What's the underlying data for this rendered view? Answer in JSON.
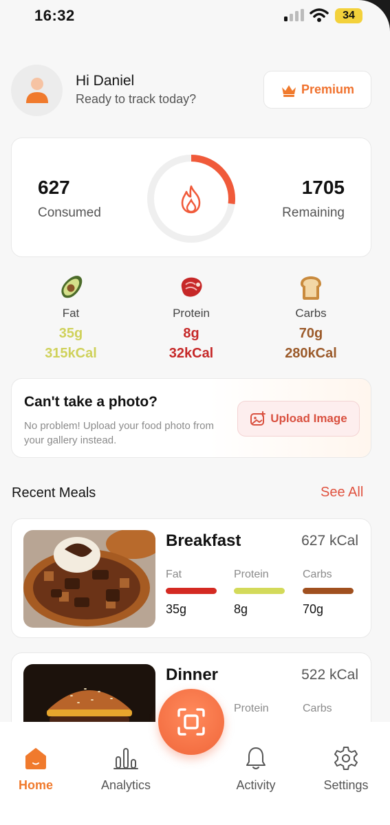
{
  "status_bar": {
    "time": "16:32",
    "battery": "34"
  },
  "header": {
    "greeting": "Hi Daniel",
    "subtitle": "Ready to track today?",
    "premium_label": "Premium"
  },
  "calories": {
    "consumed_value": "627",
    "consumed_label": "Consumed",
    "remaining_value": "1705",
    "remaining_label": "Remaining",
    "ring_progress": 0.27,
    "ring_color": "#f05a3a"
  },
  "macros": [
    {
      "name": "Fat",
      "grams": "35g",
      "kcal": "315kCal",
      "color": "#cfd15a",
      "icon": "avocado-icon"
    },
    {
      "name": "Protein",
      "grams": "8g",
      "kcal": "32kCal",
      "color": "#c62828",
      "icon": "steak-icon"
    },
    {
      "name": "Carbs",
      "grams": "70g",
      "kcal": "280kCal",
      "color": "#9b5a2a",
      "icon": "bread-icon"
    }
  ],
  "photo_card": {
    "title": "Can't take a photo?",
    "description": "No problem! Upload your food photo from your gallery instead.",
    "button_label": "Upload Image"
  },
  "recent_meals": {
    "title": "Recent Meals",
    "see_all": "See All",
    "items": [
      {
        "name": "Breakfast",
        "kcal": "627 kCal",
        "macros": [
          {
            "label": "Fat",
            "value": "35g",
            "color": "#d42a22"
          },
          {
            "label": "Protein",
            "value": "8g",
            "color": "#d3da5a"
          },
          {
            "label": "Carbs",
            "value": "70g",
            "color": "#a0501f"
          }
        ]
      },
      {
        "name": "Dinner",
        "kcal": "522 kCal",
        "macros": [
          {
            "label": "Protein"
          },
          {
            "label": "Carbs"
          }
        ]
      }
    ]
  },
  "nav": {
    "items": [
      {
        "label": "Home",
        "icon": "home-icon",
        "active": true
      },
      {
        "label": "Analytics",
        "icon": "analytics-icon"
      },
      {
        "label": "Activity",
        "icon": "bell-icon"
      },
      {
        "label": "Settings",
        "icon": "gear-icon"
      }
    ],
    "scan_icon": "scan-icon"
  }
}
